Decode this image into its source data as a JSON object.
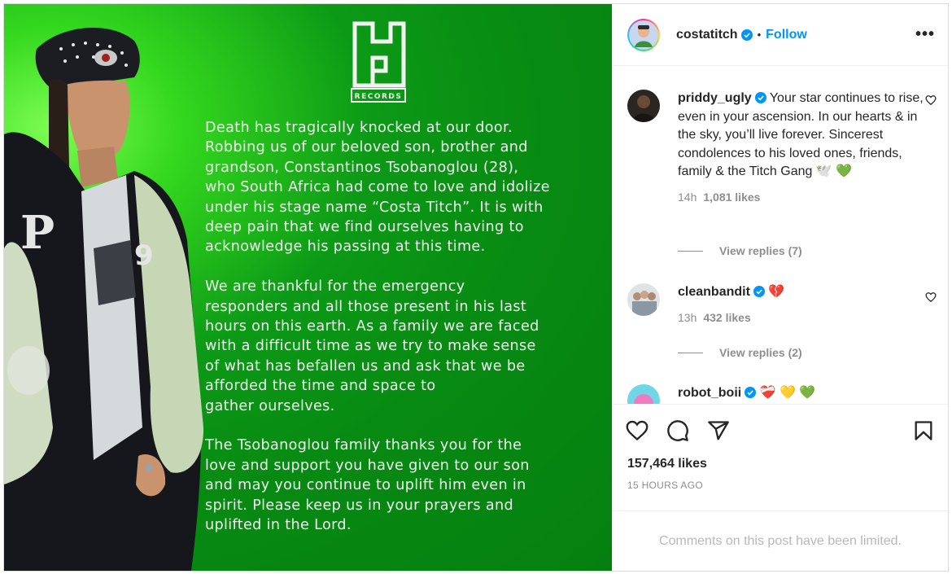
{
  "post": {
    "logo_text": "RECORDS",
    "paragraphs": [
      "Death has tragically knocked at our door.\nRobbing us of our beloved son, brother and\ngrandson, Constantinos Tsobanoglou (28),\nwho South Africa had come to love and idolize\nunder his stage name “Costa Titch”. It is with\ndeep pain that we find ourselves having to\nacknowledge his passing at this time.",
      "We are thankful for the emergency\nresponders and all those present in his last\nhours on this earth. As a family we are faced\nwith a difficult time as we try to make sense\nof what has befallen us and ask that we be\nafforded the time and space to\ngather ourselves.",
      "The Tsobanoglou family thanks you for the\nlove and support you have given to our son\nand may you continue to uplift him even in\nspirit. Please keep us in your prayers and\nuplifted in the Lord."
    ]
  },
  "header": {
    "username": "costatitch",
    "separator": "•",
    "follow_label": "Follow",
    "more_label": "•••"
  },
  "comments": [
    {
      "username": "priddy_ugly",
      "text": " Your star continues to rise, even in your ascension. In our hearts & in the sky, you’ll live forever. Sincerest condolences to his loved ones, friends, family & the Titch Gang 🕊️ 💚",
      "time": "14h",
      "likes": "1,081 likes",
      "view_replies": "View replies (7)"
    },
    {
      "username": "cleanbandit",
      "text": " 💔",
      "time": "13h",
      "likes": "432 likes",
      "view_replies": "View replies (2)"
    },
    {
      "username": "robot_boii",
      "text": " ❤️‍🩹 💛 💚"
    }
  ],
  "footer": {
    "likes": "157,464 likes",
    "time": "15 HOURS AGO",
    "limited": "Comments on this post have been limited."
  },
  "colors": {
    "accent": "#0095f6",
    "media_green": "#0a9414",
    "text_secondary": "#8e8e8e"
  },
  "icons": [
    "heart-icon",
    "comment-icon",
    "share-icon",
    "bookmark-icon",
    "verified-icon",
    "more-options-icon"
  ]
}
